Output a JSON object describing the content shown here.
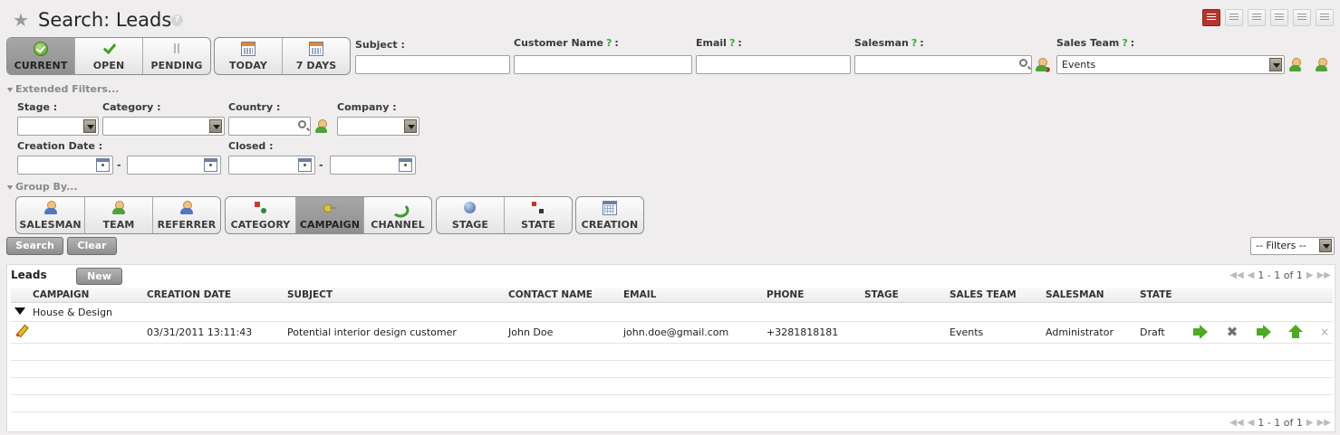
{
  "title": "Search: Leads",
  "title_help": "?",
  "filters": {
    "current": "CURRENT",
    "open": "OPEN",
    "pending": "PENDING",
    "today": "TODAY",
    "seven_days": "7 DAYS"
  },
  "fields": {
    "subject": "Subject :",
    "customer_name": "Customer Name",
    "email": "Email",
    "salesman": "Salesman",
    "sales_team": "Sales Team",
    "help_mark": "?",
    "colon": ":",
    "sales_team_value": "Events"
  },
  "extended": {
    "toggle": "Extended Filters...",
    "stage": "Stage :",
    "category": "Category :",
    "country": "Country :",
    "company": "Company :",
    "creation_date": "Creation Date :",
    "closed": "Closed :",
    "dash": "-"
  },
  "group_by": {
    "toggle": "Group By...",
    "salesman": "SALESMAN",
    "team": "TEAM",
    "referrer": "REFERRER",
    "category": "CATEGORY",
    "campaign": "CAMPAIGN",
    "channel": "CHANNEL",
    "stage": "STAGE",
    "state": "STATE",
    "creation": "CREATION"
  },
  "actions": {
    "search": "Search",
    "clear": "Clear",
    "filters_select": "-- Filters --"
  },
  "list": {
    "title": "Leads",
    "new": "New",
    "pager": "1 - 1 of 1",
    "columns": [
      "CAMPAIGN",
      "CREATION DATE",
      "SUBJECT",
      "CONTACT NAME",
      "EMAIL",
      "PHONE",
      "STAGE",
      "SALES TEAM",
      "SALESMAN",
      "STATE"
    ],
    "group_label": "House & Design",
    "row": {
      "creation_date": "03/31/2011 13:11:43",
      "subject": "Potential interior design customer",
      "contact_name": "John Doe",
      "email": "john.doe@gmail.com",
      "phone": "+3281818181",
      "sales_team": "Events",
      "salesman": "Administrator",
      "state": "Draft"
    },
    "row_close": "×"
  },
  "colors": {
    "active_view": "#b5352e",
    "success_green": "#4daa22",
    "background": "#efeded"
  }
}
